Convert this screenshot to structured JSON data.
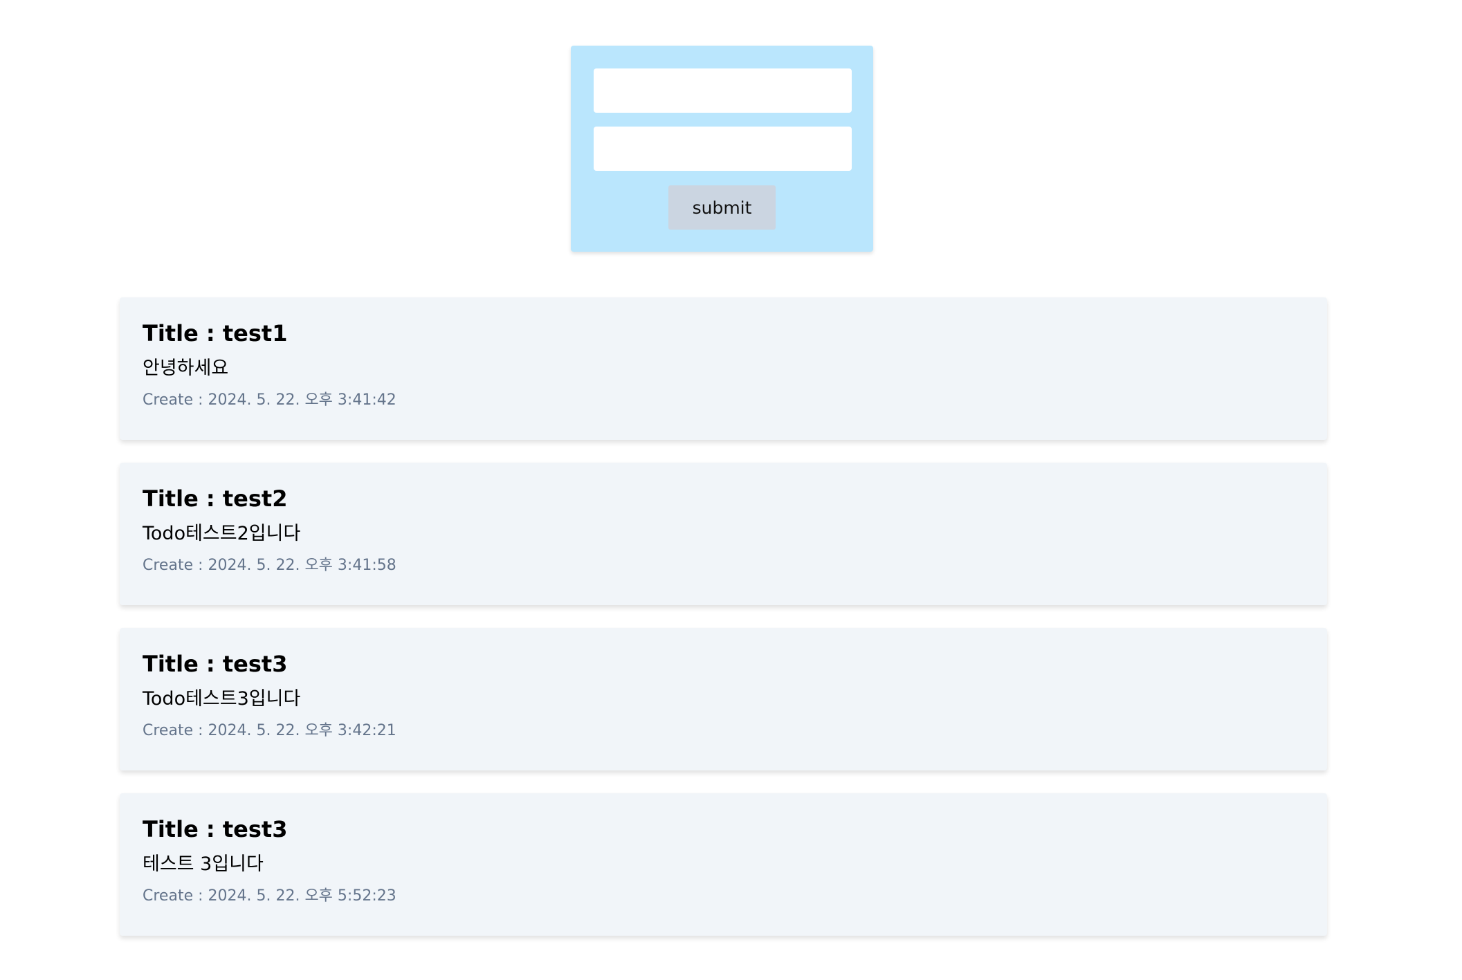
{
  "form": {
    "title_input": {
      "value": "",
      "placeholder": ""
    },
    "content_input": {
      "value": "",
      "placeholder": ""
    },
    "submit_label": "submit"
  },
  "todos": [
    {
      "title": "Title : test1",
      "content": "안녕하세요",
      "created": "Create : 2024. 5. 22. 오후 3:41:42"
    },
    {
      "title": "Title : test2",
      "content": "Todo테스트2입니다",
      "created": "Create : 2024. 5. 22. 오후 3:41:58"
    },
    {
      "title": "Title : test3",
      "content": "Todo테스트3입니다",
      "created": "Create : 2024. 5. 22. 오후 3:42:21"
    },
    {
      "title": "Title : test3",
      "content": "테스트 3입니다",
      "created": "Create : 2024. 5. 22. 오후 5:52:23"
    }
  ],
  "colors": {
    "form_background": "#bae6fd",
    "card_background": "#f1f5f9",
    "button_background": "#cbd5e1",
    "timestamp_text": "#64748b"
  }
}
